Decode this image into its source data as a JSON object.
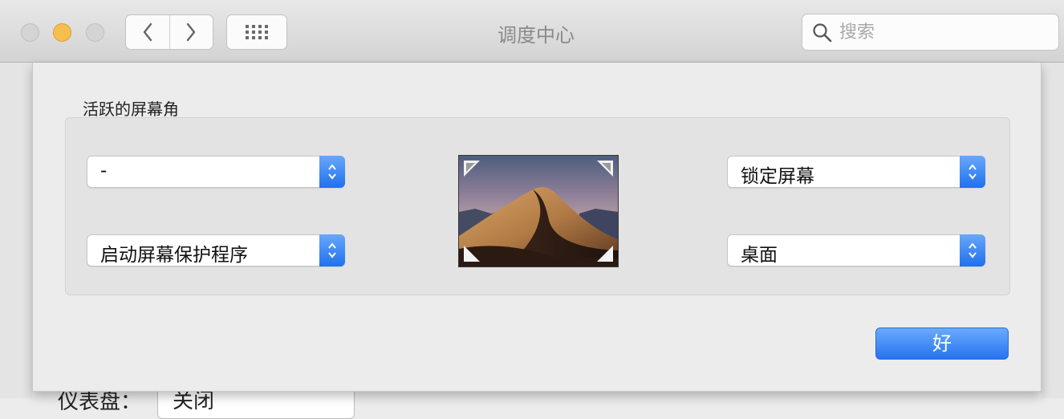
{
  "window": {
    "title": "调度中心"
  },
  "toolbar": {
    "back_icon": "chevron-left-icon",
    "forward_icon": "chevron-right-icon",
    "grid_icon": "grid-icon",
    "search": {
      "placeholder": "搜索",
      "value": "",
      "icon": "search-icon"
    }
  },
  "hot_corners": {
    "group_title": "活跃的屏幕角",
    "top_left": "-",
    "bottom_left": "启动屏幕保护程序",
    "top_right": "锁定屏幕",
    "bottom_right": "桌面",
    "preview_image": "desert-dune-wallpaper"
  },
  "sheet": {
    "ok_label": "好"
  },
  "background": {
    "partial_label": "仪表盘：",
    "partial_select": "关闭"
  },
  "colors": {
    "accent": "#2673f0",
    "minimize": "#f5be4f",
    "inactive_light": "#d4d4d4"
  }
}
